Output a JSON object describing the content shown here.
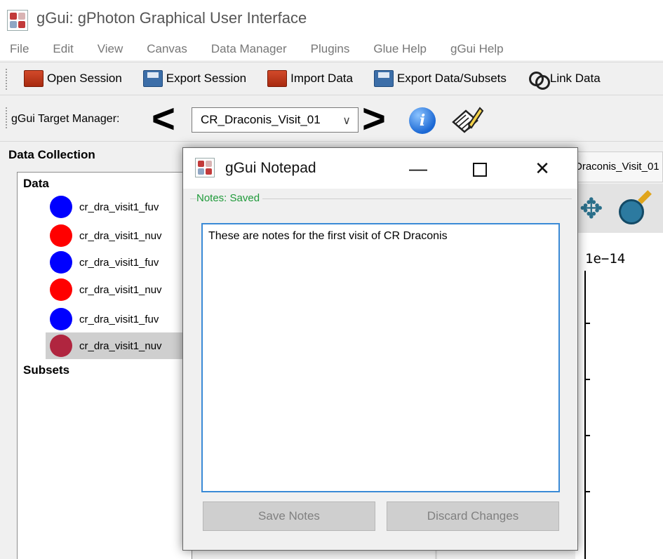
{
  "window": {
    "title": "gGui: gPhoton Graphical User Interface"
  },
  "menu": [
    "File",
    "Edit",
    "View",
    "Canvas",
    "Data Manager",
    "Plugins",
    "Glue Help",
    "gGui Help"
  ],
  "toolbar": {
    "open_session": "Open Session",
    "export_session": "Export Session",
    "import_data": "Import Data",
    "export_data": "Export Data/Subsets",
    "link_data": "Link Data"
  },
  "target_manager": {
    "label": "gGui Target Manager:",
    "prev": "<",
    "next": ">",
    "selected_target": "CR_Draconis_Visit_01",
    "info_icon": "i"
  },
  "data_collection": {
    "title": "Data Collection",
    "data_heading": "Data",
    "subsets_heading": "Subsets",
    "items": [
      {
        "name": "cr_dra_visit1_fuv",
        "color": "#0000ff"
      },
      {
        "name": "cr_dra_visit1_nuv",
        "color": "#ff0000"
      },
      {
        "name": "cr_dra_visit1_fuv",
        "color": "#0000ff"
      },
      {
        "name": "cr_dra_visit1_nuv",
        "color": "#ff0000"
      },
      {
        "name": "cr_dra_visit1_fuv",
        "color": "#0000ff"
      },
      {
        "name": "cr_dra_visit1_nuv",
        "color": "#b0253f",
        "selected": true
      }
    ]
  },
  "plot": {
    "tab_label": "Draconis_Visit_01",
    "exponent_label": "1e−14"
  },
  "notepad": {
    "title": "gGui Notepad",
    "minimize": "—",
    "close": "✕",
    "status": "Notes: Saved",
    "notes_text": "These are notes for the first visit of CR Draconis",
    "save_button": "Save Notes",
    "discard_button": "Discard Changes"
  },
  "colors": {
    "status_green": "#1f9a3a",
    "focus_border": "#3a8ad6",
    "series_blue": "#0000ff",
    "series_red": "#ff0000"
  }
}
